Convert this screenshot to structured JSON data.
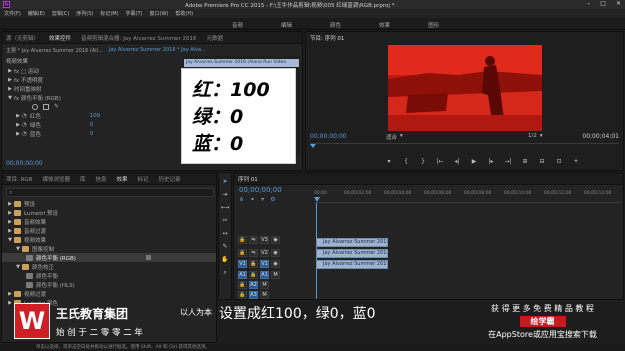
{
  "window": {
    "title": "Adobe Premiere Pro CC 2015 - F:\\王牛作品剪辑\\视频\\005 红绿蓝调\\RGB.prproj *",
    "menu": [
      "文件(F)",
      "编辑(E)",
      "剪辑(C)",
      "序列(S)",
      "标记(M)",
      "字幕(T)",
      "窗口(W)",
      "帮助(H)"
    ],
    "workspaces": [
      "音频",
      "编辑",
      "颜色",
      "效果",
      "图形"
    ],
    "controls": [
      "–",
      "□",
      "✕"
    ]
  },
  "effect_controls": {
    "tabs": [
      "源（无剪辑）",
      "效果控件",
      "音频剪辑混合器: Jay Alvarrez Summer 2016",
      "元数据"
    ],
    "active_tab": "效果控件",
    "header_source": "主要 * Jay Alvarrez Summer 2016 (Ali...",
    "header_sequence": "Jay Alvarrez Summer 2016 * Jay Alva...",
    "section_label": "视频效果",
    "clip_chip": "Jay Alvarrez Summer 2016 (Alona Run Video",
    "rows": [
      {
        "label": "fx □ 运动",
        "indent": 1,
        "value": ""
      },
      {
        "label": "fx 不透明度",
        "indent": 1,
        "value": ""
      },
      {
        "label": "时间重映射",
        "indent": 1,
        "value": ""
      },
      {
        "label": "fx 颜色平衡 (RGB)",
        "indent": 1,
        "value": ""
      },
      {
        "label": "",
        "indent": 2,
        "value": ""
      },
      {
        "label": "红色",
        "indent": 2,
        "value": "100"
      },
      {
        "label": "绿色",
        "indent": 2,
        "value": "0"
      },
      {
        "label": "蓝色",
        "indent": 2,
        "value": "0"
      }
    ],
    "timecode": "00;00;00;00"
  },
  "overlay_card": {
    "lines": [
      "红：100",
      "绿：0",
      "蓝：0"
    ]
  },
  "program_monitor": {
    "tab": "节目: 序列 01",
    "timecode_left": "00;00;00;00",
    "fit": "适合",
    "ratio": "1/2",
    "timecode_right": "00;00;04;01",
    "transport": [
      "▾",
      "{",
      "}",
      "|←",
      "◂|",
      "▶",
      "|▸",
      "→|",
      "⊞",
      "⊟",
      "⊡",
      "+"
    ]
  },
  "project_panel": {
    "tabs": [
      "项目: RGB",
      "媒体浏览器",
      "库",
      "信息",
      "效果",
      "标记",
      "历史记录"
    ],
    "active_tab": "效果",
    "items": [
      {
        "label": "预设",
        "indent": 1,
        "kind": "folder"
      },
      {
        "label": "Lumetri 预设",
        "indent": 1,
        "kind": "folder"
      },
      {
        "label": "音频效果",
        "indent": 1,
        "kind": "folder"
      },
      {
        "label": "音频过渡",
        "indent": 1,
        "kind": "folder"
      },
      {
        "label": "视频效果",
        "indent": 1,
        "kind": "folder"
      },
      {
        "label": "图像控制",
        "indent": 2,
        "kind": "folder"
      },
      {
        "label": "颜色平衡 (RGB)",
        "indent": 3,
        "kind": "fx",
        "selected": true
      },
      {
        "label": "颜色校正",
        "indent": 2,
        "kind": "folder"
      },
      {
        "label": "颜色平衡",
        "indent": 3,
        "kind": "fx"
      },
      {
        "label": "颜色平衡 (HLS)",
        "indent": 3,
        "kind": "fx"
      },
      {
        "label": "视频过渡",
        "indent": 1,
        "kind": "folder"
      },
      {
        "label": "Lumetri 颜色",
        "indent": 1,
        "kind": "folder"
      }
    ]
  },
  "timeline": {
    "tab": "序列 01",
    "timecode": "00;00;00;00",
    "ruler": [
      "00;00",
      "00;00;02;00",
      "00;00;04;00",
      "00;00;06;00",
      "00;00;08;00",
      "00;00;10;00",
      "00;00;12;00",
      "00;00;14;00"
    ],
    "tracks": [
      {
        "name": "V3",
        "type": "video"
      },
      {
        "name": "V2",
        "type": "video"
      },
      {
        "name": "V1",
        "type": "video"
      },
      {
        "name": "A1",
        "type": "audio"
      },
      {
        "name": "A2",
        "type": "audio"
      },
      {
        "name": "A3",
        "type": "audio"
      }
    ],
    "clips": [
      {
        "label": "Jay Alvarrez Summer 2016 (Alo",
        "track": 0,
        "type": "video"
      },
      {
        "label": "Jay Alvarrez Summer 2016 (Alo",
        "track": 1,
        "type": "video"
      },
      {
        "label": "Jay Alvarrez Summer 2016 (Alo",
        "track": 2,
        "type": "video"
      }
    ]
  },
  "watermark": {
    "logo_letter": "W",
    "company": "王氏教育集团",
    "slogan_right": "以人为本",
    "slogan_bottom": "始 创 于 二 零 零 二 年"
  },
  "subtitle": "设置成红100，绿0，蓝0",
  "promo": {
    "line1": "获 得 更 多 免 费 精 品 教 程",
    "badge": "绘学霸",
    "line3": "在AppStore或应用宝搜索下载"
  },
  "status_bar": "单击以选择，或单击空白处并拖动以进行框选。使用 Shift、Alt 和 Ctrl 获得其他选项。",
  "colors": {
    "accent_blue": "#2d8ceb",
    "program_red": "#d0201a",
    "logo_red": "#cf1f25",
    "badge_red": "#c8191e"
  }
}
